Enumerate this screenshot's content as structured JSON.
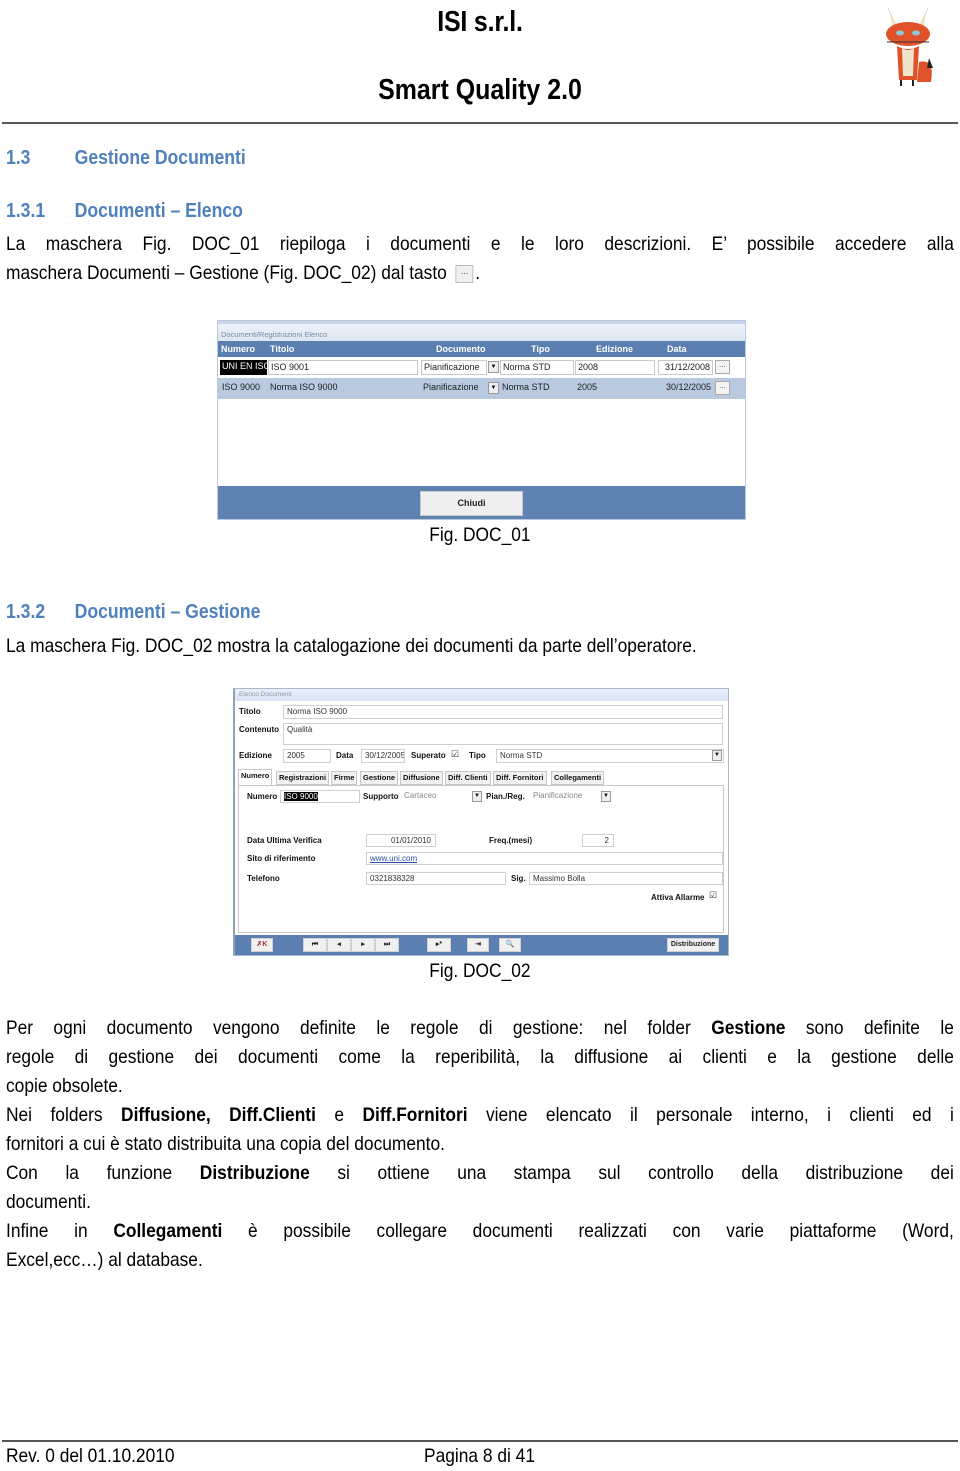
{
  "header": {
    "company": "ISI s.r.l.",
    "product": "Smart Quality 2.0",
    "logo": "fox-logo-icon"
  },
  "section": {
    "number": "1.3",
    "title": "Gestione Documenti"
  },
  "subsection1": {
    "number": "1.3.1",
    "title": "Documenti – Elenco",
    "para_line1": "La maschera Fig. DOC_01 riepiloga i documenti e le loro descrizioni. E’ possibile accedere alla",
    "para_line2_a": "maschera Documenti – Gestione (Fig. DOC_02) dal tasto",
    "para_line2_b": ".",
    "inline_button": "..."
  },
  "fig1": {
    "window_title": "Documenti/Registrazioni Elenco",
    "columns": [
      "Numero",
      "Titolo",
      "Documento",
      "Tipo",
      "Edizione",
      "Data"
    ],
    "rows": [
      {
        "numero": "UNI EN ISO",
        "titolo": "ISO 9001",
        "documento": "Pianificazione",
        "tipo": "Norma STD",
        "edizione": "2008",
        "data": "31/12/2008",
        "action": "..."
      },
      {
        "numero": "ISO 9000",
        "titolo": "Norma ISO 9000",
        "documento": "Pianificazione",
        "tipo": "Norma STD",
        "edizione": "2005",
        "data": "30/12/2005",
        "action": "..."
      }
    ],
    "close_button": "Chiudi",
    "caption": "Fig. DOC_01"
  },
  "subsection2": {
    "number": "1.3.2",
    "title": "Documenti – Gestione",
    "para": "La maschera Fig. DOC_02 mostra la catalogazione dei documenti  da parte dell’operatore."
  },
  "fig2": {
    "window_title": "Elenco Documenti",
    "titolo_label": "Titolo",
    "titolo_value": "Norma ISO 9000",
    "contenuto_label": "Contenuto",
    "contenuto_value": "Qualità",
    "edizione_label": "Edizione",
    "edizione_value": "2005",
    "data_label": "Data",
    "data_value": "30/12/2005",
    "superato_label": "Superato",
    "superato_checked": true,
    "tipo_label": "Tipo",
    "tipo_value": "Norma STD",
    "tabs": [
      "Numero",
      "Registrazioni",
      "Firme",
      "Gestione",
      "Diffusione",
      "Diff. Clienti",
      "Diff. Fornitori",
      "Collegamenti"
    ],
    "active_tab": "Numero",
    "numero_label": "Numero",
    "numero_value": "ISO 9000",
    "supporto_label": "Supporto",
    "supporto_value": "Cartaceo",
    "pianreg_label": "Pian./Reg.",
    "pianreg_value": "Pianificazione",
    "data_verifica_label": "Data Ultima Verifica",
    "data_verifica_value": "01/01/2010",
    "freq_label": "Freq.(mesi)",
    "freq_value": "2",
    "sito_label": "Sito di riferimento",
    "sito_value": "www.uni.com",
    "telefono_label": "Telefono",
    "telefono_value": "0321838328",
    "sig_label": "Sig.",
    "sig_value": "Massimo Bolla",
    "allarme_label": "Attiva Allarme",
    "allarme_checked": true,
    "nav": {
      "delete": "✗K",
      "first": "⏮",
      "prev": "◂",
      "next": "▸",
      "last": "⏭",
      "new": "▸*",
      "exit": "⇥",
      "find": "🔍",
      "distribuzione": "Distribuzione"
    },
    "caption": "Fig. DOC_02"
  },
  "body": {
    "p1_l1_a": "Per ogni documento vengono definite le regole di gestione: nel folder ",
    "p1_l1_b": "Gestione",
    "p1_l1_c": " sono definite le",
    "p1_l2": "regole di gestione dei documenti come la reperibilità, la diffusione ai clienti e la gestione delle",
    "p1_l3": "copie obsolete.",
    "p2_l1_a": "Nei folders ",
    "p2_l1_b": "Diffusione, Diff.Clienti",
    "p2_l1_c": " e ",
    "p2_l1_d": "Diff.Fornitori",
    "p2_l1_e": " viene elencato il personale interno, i clienti ed i",
    "p2_l2": "fornitori a cui è stato distribuita una copia del documento.",
    "p3_l1_a": "Con la funzione ",
    "p3_l1_b": "Distribuzione",
    "p3_l1_c": " si ottiene una stampa sul controllo della distribuzione dei",
    "p3_l2": "documenti.",
    "p4_l1_a": "Infine in ",
    "p4_l1_b": "Collegamenti",
    "p4_l1_c": " è possibile collegare documenti realizzati con varie piattaforme (Word,",
    "p4_l2": "Excel,ecc…) al database."
  },
  "footer": {
    "revision": "Rev. 0 del 01.10.2010",
    "page": "Pagina 8 di 41"
  }
}
